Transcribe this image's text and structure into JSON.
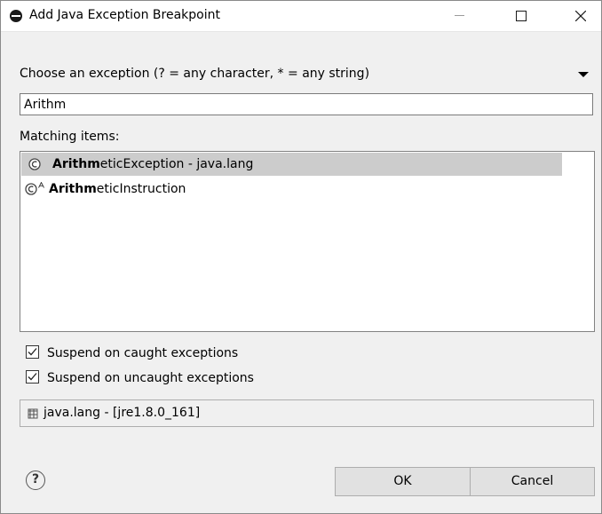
{
  "window": {
    "title": "Add Java Exception Breakpoint"
  },
  "chooser": {
    "label": "Choose an exception (? = any character, * = any string)",
    "filter_value": "Arithm"
  },
  "matching": {
    "label": "Matching items:",
    "items": [
      {
        "bold": "Arithm",
        "rest": "eticException - java.lang",
        "icon": "class-icon",
        "selected": true
      },
      {
        "bold": "Arithm",
        "rest": "eticInstruction",
        "icon": "abstract-class-icon",
        "selected": false
      }
    ]
  },
  "options": {
    "suspend_caught_label": "Suspend on caught exceptions",
    "suspend_caught_checked": true,
    "suspend_uncaught_label": "Suspend on uncaught exceptions",
    "suspend_uncaught_checked": true
  },
  "status": {
    "icon": "package-icon",
    "text": "java.lang - [jre1.8.0_161]"
  },
  "buttons": {
    "help": "?",
    "ok": "OK",
    "cancel": "Cancel"
  }
}
